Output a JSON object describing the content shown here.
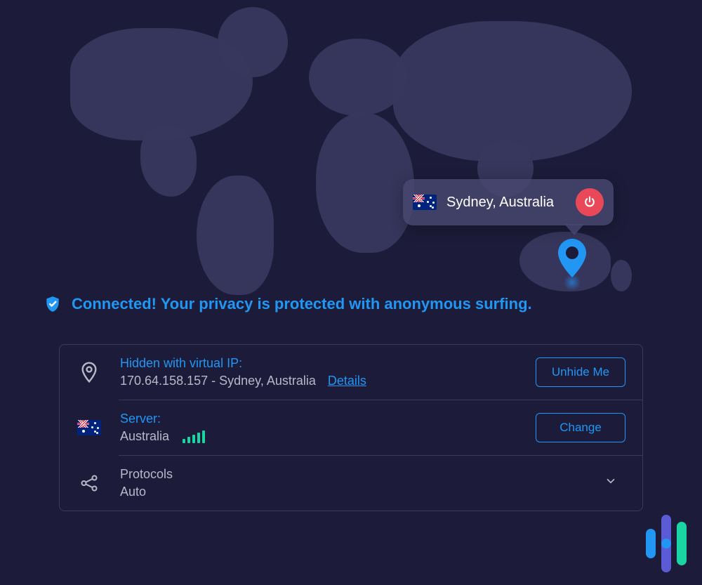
{
  "tooltip": {
    "location": "Sydney, Australia",
    "flag_country": "Australia"
  },
  "status": {
    "message": "Connected! Your privacy is protected with anonymous surfing."
  },
  "panel": {
    "ip": {
      "label": "Hidden with virtual IP:",
      "value": "170.64.158.157 - Sydney, Australia",
      "details_link": "Details",
      "button": "Unhide Me"
    },
    "server": {
      "label": "Server:",
      "value": "Australia",
      "button": "Change",
      "signal_strength": 5
    },
    "protocols": {
      "label": "Protocols",
      "value": "Auto"
    }
  }
}
